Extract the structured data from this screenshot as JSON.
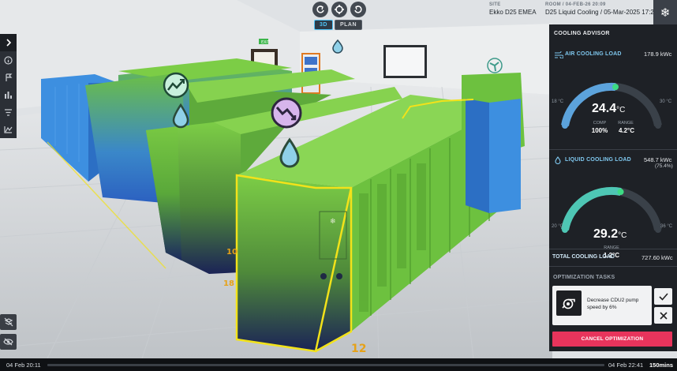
{
  "header": {
    "site_label": "SITE",
    "site_value": "Ekko D25 EMEA",
    "room_label": "ROOM / 04-FEB-26 20:09",
    "room_value": "D25 Liquid Cooling / 05-Mar-2025 17:22"
  },
  "view_toggle": {
    "mode_3d": "3D",
    "mode_plan": "PLAN",
    "active": "3D"
  },
  "scene": {
    "floor_labels": [
      "10",
      "18",
      "12"
    ],
    "exit_sign": "EXIT"
  },
  "panel": {
    "title": "COOLING ADVISOR",
    "air": {
      "label": "AIR COOLING LOAD",
      "load": "178.9 kWc",
      "min": "18 °C",
      "max": "30 °C",
      "temp": "24.4",
      "temp_unit": "°C",
      "comp_label": "COMP",
      "comp_value": "100%",
      "range_label": "RANGE",
      "range_value": "4.2°C",
      "temp_fraction": 0.53
    },
    "liquid": {
      "label": "LIQUID COOLING LOAD",
      "load": "548.7 kWc",
      "load_pct": "(75.4%)",
      "min": "20 °C",
      "max": "36 °C",
      "temp": "29.2",
      "temp_unit": "°C",
      "range_label": "RANGE",
      "range_value": "1.2°C",
      "temp_fraction": 0.57
    },
    "total": {
      "label": "TOTAL COOLING LOAD",
      "value": "727.60 kWc"
    },
    "tasks": {
      "title": "OPTIMIZATION TASKS",
      "items": [
        {
          "text": "Decrease CDU2 pump speed by 6%"
        }
      ],
      "cancel_label": "CANCEL OPTIMIZATION"
    }
  },
  "timeline": {
    "start": "04 Feb 20:11",
    "end": "04 Feb 22:41",
    "duration": "150mins"
  },
  "colors": {
    "accent_blue": "#4fc3f7",
    "gauge_green": "#3ddc84",
    "cancel_red": "#e8345c",
    "rack_green": "#6dc13f",
    "rack_blue": "#3d8fe0",
    "highlight_yellow": "#f2e21a"
  }
}
